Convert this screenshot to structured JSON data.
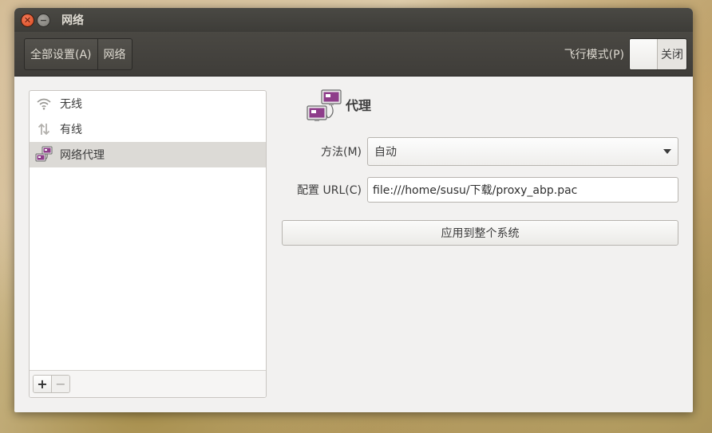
{
  "window": {
    "title": "网络"
  },
  "toolbar": {
    "breadcrumb": [
      "全部设置(A)",
      "网络"
    ],
    "airplane_label": "飞行模式(P)",
    "airplane_state": "关闭"
  },
  "sidebar": {
    "items": [
      {
        "label": "无线",
        "icon": "wifi-icon"
      },
      {
        "label": "有线",
        "icon": "wired-icon"
      },
      {
        "label": "网络代理",
        "icon": "proxy-icon",
        "selected": true
      }
    ],
    "add_label": "+",
    "remove_label": "−"
  },
  "detail": {
    "title": "代理",
    "method_label": "方法(M)",
    "method_value": "自动",
    "url_label": "配置 URL(C)",
    "url_value": "file:///home/susu/下载/proxy_abp.pac",
    "apply_label": "应用到整个系统"
  }
}
